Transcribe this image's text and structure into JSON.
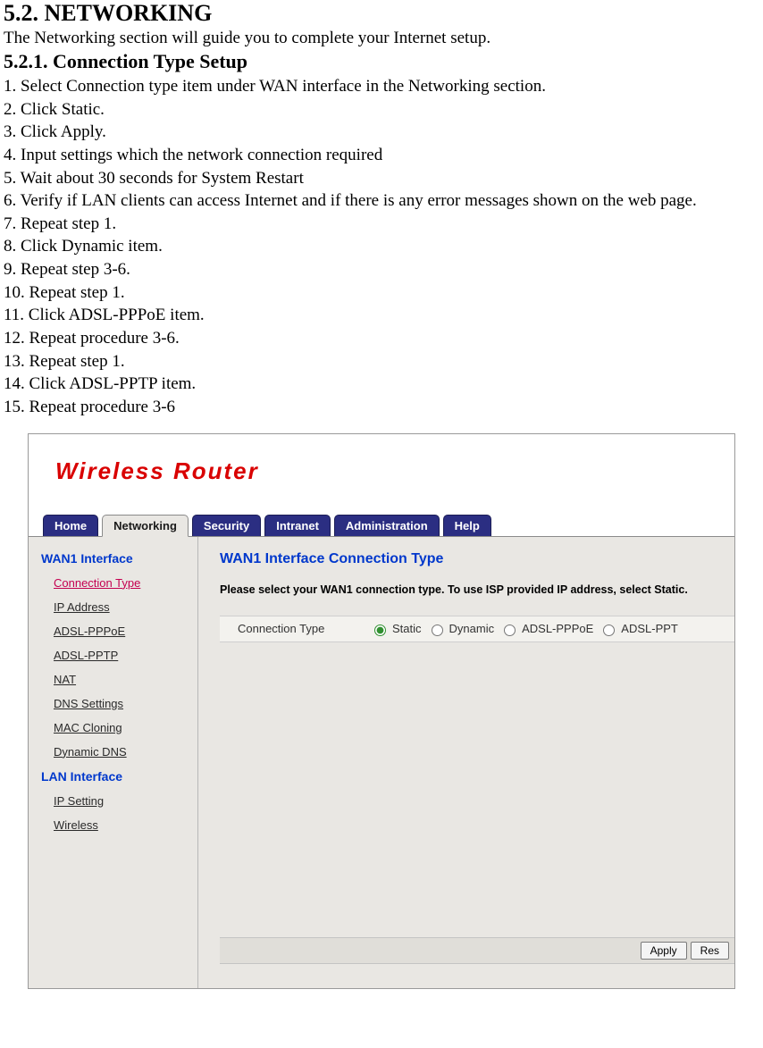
{
  "doc": {
    "section_heading": "5.2. NETWORKING",
    "intro": "The Networking section will guide you to complete your Internet setup.",
    "subsection_heading": "5.2.1. Connection Type Setup",
    "steps": [
      "1. Select Connection type item under WAN interface in the Networking section.",
      "2. Click Static.",
      "3. Click Apply.",
      "4. Input settings which the network connection required",
      "5. Wait about 30 seconds for System Restart",
      "6. Verify if LAN clients can access Internet and if there is any error messages shown on the web page.",
      "7. Repeat step 1.",
      "8. Click Dynamic item.",
      "9. Repeat step 3-6.",
      "10. Repeat step 1.",
      "11. Click ADSL-PPPoE item.",
      "12. Repeat procedure 3-6.",
      "13. Repeat step 1.",
      "14. Click ADSL-PPTP item.",
      "15. Repeat procedure 3-6"
    ]
  },
  "router": {
    "brand_title": "Wireless Router",
    "tabs": [
      "Home",
      "Networking",
      "Security",
      "Intranet",
      "Administration",
      "Help"
    ],
    "sidebar": {
      "group1_title": "WAN1 Interface",
      "group1_items": [
        "Connection Type",
        "IP Address",
        "ADSL-PPPoE",
        "ADSL-PPTP",
        "NAT",
        "DNS Settings",
        "MAC Cloning",
        "Dynamic DNS"
      ],
      "group2_title": "LAN Interface",
      "group2_items": [
        "IP Setting",
        "Wireless"
      ]
    },
    "content": {
      "title": "WAN1 Interface Connection Type",
      "instruction": "Please select your WAN1 connection type. To use ISP provided IP address, select Static.",
      "row_label": "Connection Type",
      "options": [
        "Static",
        "Dynamic",
        "ADSL-PPPoE",
        "ADSL-PPT"
      ],
      "selected": "Static",
      "buttons": {
        "apply": "Apply",
        "reset": "Res"
      }
    }
  }
}
